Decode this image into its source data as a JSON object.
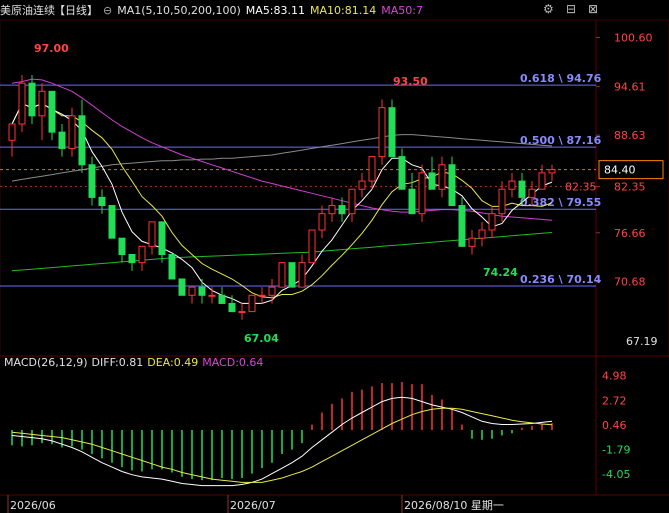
{
  "header": {
    "title": "美原油连续",
    "period": "【日线】",
    "ma1": "MA1(5,10,50,200,100)",
    "ma5": "MA5:83.11",
    "ma10": "MA10:81.14",
    "ma50": "MA50:7",
    "colors": {
      "ma5": "#ffffff",
      "ma10": "#e8e84a",
      "ma50": "#e040e0",
      "ma200": "#22bb22",
      "ma100": "#999999"
    }
  },
  "toolbar": {
    "icons": [
      "settings-icon",
      "collapse-icon",
      "close-icon"
    ]
  },
  "macd_header": {
    "title": "MACD(26,12,9)",
    "diff": "DIFF:0.81",
    "dea": "DEA:0.49",
    "macd": "MACD:0.64"
  },
  "price_axis": {
    "ticks": [
      "100.60",
      "94.61",
      "88.63",
      "82.35",
      "76.66",
      "70.68",
      "67.19"
    ],
    "current_price": "84.40",
    "bottom_label": "67.19"
  },
  "macd_axis": {
    "ticks": [
      "4.98",
      "2.72",
      "0.46",
      "-1.79",
      "-4.05"
    ]
  },
  "date_axis": {
    "labels": [
      "2026/06",
      "2026/07",
      "2026/08/10 星期一"
    ]
  },
  "chart_data": {
    "type": "candlestick",
    "ylim": [
      64.5,
      102.5
    ],
    "annotations": {
      "high_1": "97.00",
      "high_2": "93.50",
      "low_1": "67.04",
      "low_2": "74.24",
      "price_marker": "82.35"
    },
    "fib_levels": [
      {
        "label": "0.618 \\ 94.76",
        "value": 94.76
      },
      {
        "label": "0.500 \\ 87.16",
        "value": 87.16
      },
      {
        "label": "0.382 \\ 79.55",
        "value": 79.55
      },
      {
        "label": "0.236 \\ 70.14",
        "value": 70.14
      }
    ],
    "current_price": 84.4,
    "candles": [
      [
        88,
        90,
        86,
        90
      ],
      [
        90,
        96,
        89,
        95
      ],
      [
        95,
        96,
        90,
        91
      ],
      [
        91,
        95,
        88,
        94
      ],
      [
        94,
        94,
        88,
        89
      ],
      [
        89,
        90,
        86,
        87
      ],
      [
        87,
        92,
        86,
        91
      ],
      [
        91,
        93,
        84,
        85
      ],
      [
        85,
        86,
        80,
        81
      ],
      [
        81,
        82,
        79,
        80
      ],
      [
        80,
        80,
        76,
        76
      ],
      [
        76,
        76,
        73,
        74
      ],
      [
        74,
        74,
        72,
        73
      ],
      [
        73,
        75,
        72,
        75
      ],
      [
        75,
        78,
        74,
        78
      ],
      [
        78,
        78,
        73,
        74
      ],
      [
        74,
        74,
        71,
        71
      ],
      [
        71,
        71,
        69,
        69
      ],
      [
        69,
        70,
        68,
        70
      ],
      [
        70,
        71,
        68,
        69
      ],
      [
        69,
        70,
        68,
        69
      ],
      [
        69,
        70,
        68,
        68
      ],
      [
        68,
        69,
        67,
        67
      ],
      [
        67,
        68,
        66,
        67
      ],
      [
        67,
        69,
        67,
        69
      ],
      [
        69,
        70,
        68,
        69
      ],
      [
        69,
        71,
        68,
        70
      ],
      [
        70,
        73,
        70,
        73
      ],
      [
        73,
        73,
        70,
        70
      ],
      [
        70,
        74,
        70,
        73
      ],
      [
        73,
        77,
        73,
        77
      ],
      [
        77,
        80,
        76,
        79
      ],
      [
        79,
        81,
        78,
        80
      ],
      [
        80,
        81,
        78,
        79
      ],
      [
        79,
        82,
        78,
        82
      ],
      [
        82,
        84,
        81,
        83
      ],
      [
        83,
        86,
        82,
        86
      ],
      [
        86,
        93,
        85,
        92
      ],
      [
        92,
        93,
        86,
        86
      ],
      [
        86,
        87,
        82,
        82
      ],
      [
        82,
        84,
        79,
        79
      ],
      [
        79,
        85,
        78,
        84
      ],
      [
        84,
        86,
        82,
        82
      ],
      [
        82,
        86,
        81,
        85
      ],
      [
        85,
        86,
        80,
        80
      ],
      [
        80,
        81,
        75,
        75
      ],
      [
        75,
        77,
        74,
        76
      ],
      [
        76,
        78,
        75,
        77
      ],
      [
        77,
        80,
        76,
        79
      ],
      [
        79,
        83,
        78,
        82
      ],
      [
        82,
        84,
        81,
        83
      ],
      [
        83,
        84,
        80,
        81
      ],
      [
        81,
        83,
        80,
        82
      ],
      [
        82,
        85,
        82,
        84
      ],
      [
        84,
        85,
        83,
        84.4
      ]
    ],
    "series": [
      {
        "name": "MA5",
        "color": "#ffffff"
      },
      {
        "name": "MA10",
        "color": "#e8e84a"
      },
      {
        "name": "MA50",
        "color": "#e040e0"
      },
      {
        "name": "MA200",
        "color": "#22bb22"
      },
      {
        "name": "MA100",
        "color": "#999999"
      }
    ],
    "ma50": [
      95,
      95.2,
      95.5,
      95.4,
      95,
      94.5,
      94,
      93.2,
      92.3,
      91.4,
      90.5,
      89.7,
      89,
      88.3,
      87.7,
      87.2,
      86.7,
      86.2,
      85.8,
      85.4,
      85,
      84.6,
      84.2,
      83.8,
      83.4,
      83,
      82.7,
      82.4,
      82.1,
      81.8,
      81.5,
      81.2,
      80.9,
      80.6,
      80.3,
      80,
      79.7,
      79.5,
      79.3,
      79.2,
      79.2,
      79.3,
      79.4,
      79.5,
      79.5,
      79.4,
      79.3,
      79.1,
      78.9,
      78.7,
      78.6,
      78.5,
      78.4,
      78.3,
      78.2
    ],
    "ma200": [
      72,
      72.1,
      72.2,
      72.3,
      72.4,
      72.5,
      72.6,
      72.7,
      72.8,
      72.9,
      73,
      73.1,
      73.2,
      73.3,
      73.4,
      73.5,
      73.6,
      73.65,
      73.7,
      73.75,
      73.8,
      73.85,
      73.9,
      73.95,
      74,
      74.05,
      74.1,
      74.15,
      74.2,
      74.25,
      74.3,
      74.4,
      74.5,
      74.6,
      74.7,
      74.8,
      74.9,
      75,
      75.1,
      75.2,
      75.3,
      75.4,
      75.5,
      75.6,
      75.7,
      75.8,
      75.9,
      76,
      76.1,
      76.2,
      76.3,
      76.4,
      76.5,
      76.6,
      76.7
    ],
    "ma100": [
      83,
      83.2,
      83.4,
      83.6,
      83.8,
      84,
      84.2,
      84.4,
      84.6,
      84.8,
      85,
      85.1,
      85.2,
      85.3,
      85.4,
      85.5,
      85.5,
      85.6,
      85.6,
      85.7,
      85.7,
      85.8,
      85.8,
      85.9,
      86,
      86.1,
      86.2,
      86.4,
      86.6,
      86.8,
      87,
      87.2,
      87.4,
      87.6,
      87.8,
      88,
      88.2,
      88.4,
      88.6,
      88.7,
      88.7,
      88.6,
      88.5,
      88.4,
      88.3,
      88.2,
      88.1,
      88,
      87.9,
      87.8,
      87.7,
      87.6,
      87.5,
      87.4,
      87.3
    ],
    "macd": {
      "ylim": [
        -5.5,
        5.5
      ],
      "hist": [
        -1.4,
        -1.5,
        -1.4,
        -1.2,
        -1.3,
        -1.6,
        -1.5,
        -1.8,
        -2.2,
        -2.6,
        -3,
        -3.4,
        -3.7,
        -3.8,
        -3.6,
        -3.6,
        -3.9,
        -4.3,
        -4.5,
        -4.6,
        -4.6,
        -4.4,
        -4.5,
        -4.4,
        -4,
        -3.5,
        -3,
        -2.2,
        -1.8,
        -1.2,
        0.5,
        1.6,
        2.4,
        2.9,
        3.5,
        3.7,
        4.0,
        4.3,
        4.3,
        4.4,
        4.2,
        4.2,
        3.2,
        2.8,
        1.9,
        0.5,
        -0.8,
        -0.9,
        -0.8,
        -0.5,
        -0.3,
        0.2,
        0.4,
        0.5,
        0.64
      ],
      "diff": [
        -0.5,
        -0.6,
        -0.7,
        -0.8,
        -1,
        -1.3,
        -1.6,
        -2,
        -2.5,
        -3,
        -3.4,
        -3.8,
        -4.1,
        -4.3,
        -4.4,
        -4.5,
        -4.7,
        -4.9,
        -5,
        -5.1,
        -5.1,
        -5.1,
        -5.1,
        -5,
        -4.8,
        -4.5,
        -4,
        -3.5,
        -3,
        -2.4,
        -1.6,
        -0.9,
        -0.2,
        0.5,
        1.1,
        1.6,
        2.1,
        2.6,
        2.9,
        3,
        2.9,
        2.6,
        2.3,
        2.1,
        1.9,
        1.6,
        1.2,
        0.8,
        0.6,
        0.5,
        0.5,
        0.55,
        0.6,
        0.7,
        0.81
      ],
      "dea": [
        -0.2,
        -0.3,
        -0.4,
        -0.5,
        -0.6,
        -0.7,
        -0.9,
        -1.1,
        -1.3,
        -1.6,
        -1.9,
        -2.2,
        -2.5,
        -2.8,
        -3.1,
        -3.4,
        -3.6,
        -3.9,
        -4.1,
        -4.3,
        -4.5,
        -4.6,
        -4.7,
        -4.8,
        -4.8,
        -4.8,
        -4.6,
        -4.4,
        -4.1,
        -3.8,
        -3.4,
        -2.9,
        -2.4,
        -1.9,
        -1.4,
        -0.9,
        -0.4,
        0.1,
        0.6,
        1,
        1.4,
        1.7,
        1.9,
        2,
        2,
        1.9,
        1.7,
        1.5,
        1.3,
        1.1,
        0.9,
        0.75,
        0.65,
        0.55,
        0.49
      ]
    }
  }
}
